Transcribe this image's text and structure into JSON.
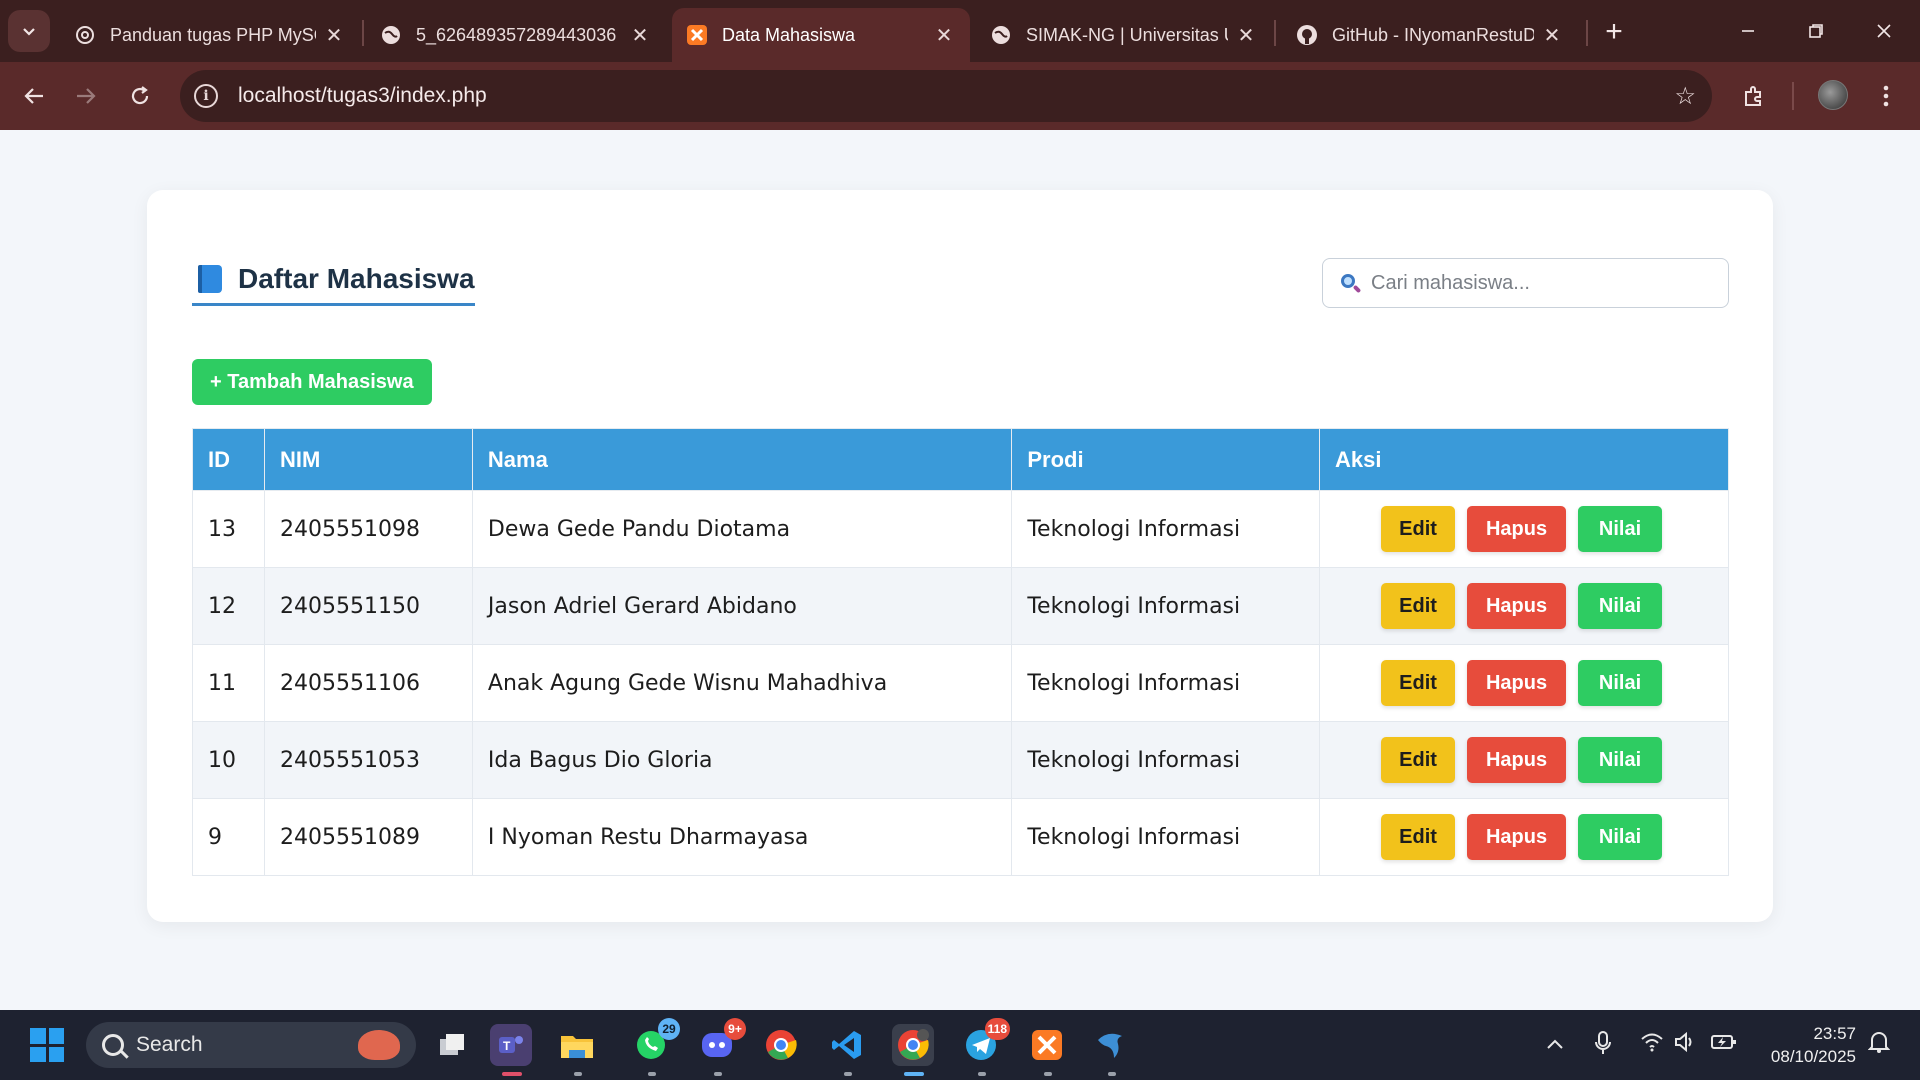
{
  "browser": {
    "tabs": [
      {
        "title": "Panduan tugas PHP MySQL",
        "icon": "openai-icon"
      },
      {
        "title": "5_626489357289443036",
        "icon": "globe-icon"
      },
      {
        "title": "Data Mahasiswa",
        "icon": "xampp-icon",
        "active": true
      },
      {
        "title": "SIMAK-NG | Universitas Udayana",
        "icon": "globe-icon"
      },
      {
        "title": "GitHub - INyomanRestuD",
        "icon": "github-icon"
      }
    ],
    "url": "localhost/tugas3/index.php"
  },
  "page": {
    "heading": "Daftar Mahasiswa",
    "search_placeholder": "Cari mahasiswa...",
    "add_button": "+ Tambah Mahasiswa",
    "table": {
      "headers": [
        "ID",
        "NIM",
        "Nama",
        "Prodi",
        "Aksi"
      ],
      "rows": [
        {
          "id": "13",
          "nim": "2405551098",
          "nama": "Dewa Gede Pandu Diotama",
          "prodi": "Teknologi Informasi"
        },
        {
          "id": "12",
          "nim": "2405551150",
          "nama": "Jason Adriel Gerard Abidano",
          "prodi": "Teknologi Informasi"
        },
        {
          "id": "11",
          "nim": "2405551106",
          "nama": "Anak Agung Gede Wisnu Mahadhiva",
          "prodi": "Teknologi Informasi"
        },
        {
          "id": "10",
          "nim": "2405551053",
          "nama": "Ida Bagus Dio Gloria",
          "prodi": "Teknologi Informasi"
        },
        {
          "id": "9",
          "nim": "2405551089",
          "nama": "I Nyoman Restu Dharmayasa",
          "prodi": "Teknologi Informasi"
        }
      ],
      "actions": {
        "edit": "Edit",
        "hapus": "Hapus",
        "nilai": "Nilai"
      }
    },
    "colors": {
      "header": "#3a9ad9",
      "edit": "#f2c21b",
      "hapus": "#e74c3c",
      "nilai": "#2ecc62"
    }
  },
  "taskbar": {
    "search_label": "Search",
    "badges": {
      "whatsapp": "29",
      "discord": "9+",
      "telegram": "118"
    },
    "time": "23:57",
    "date": "08/10/2025"
  }
}
